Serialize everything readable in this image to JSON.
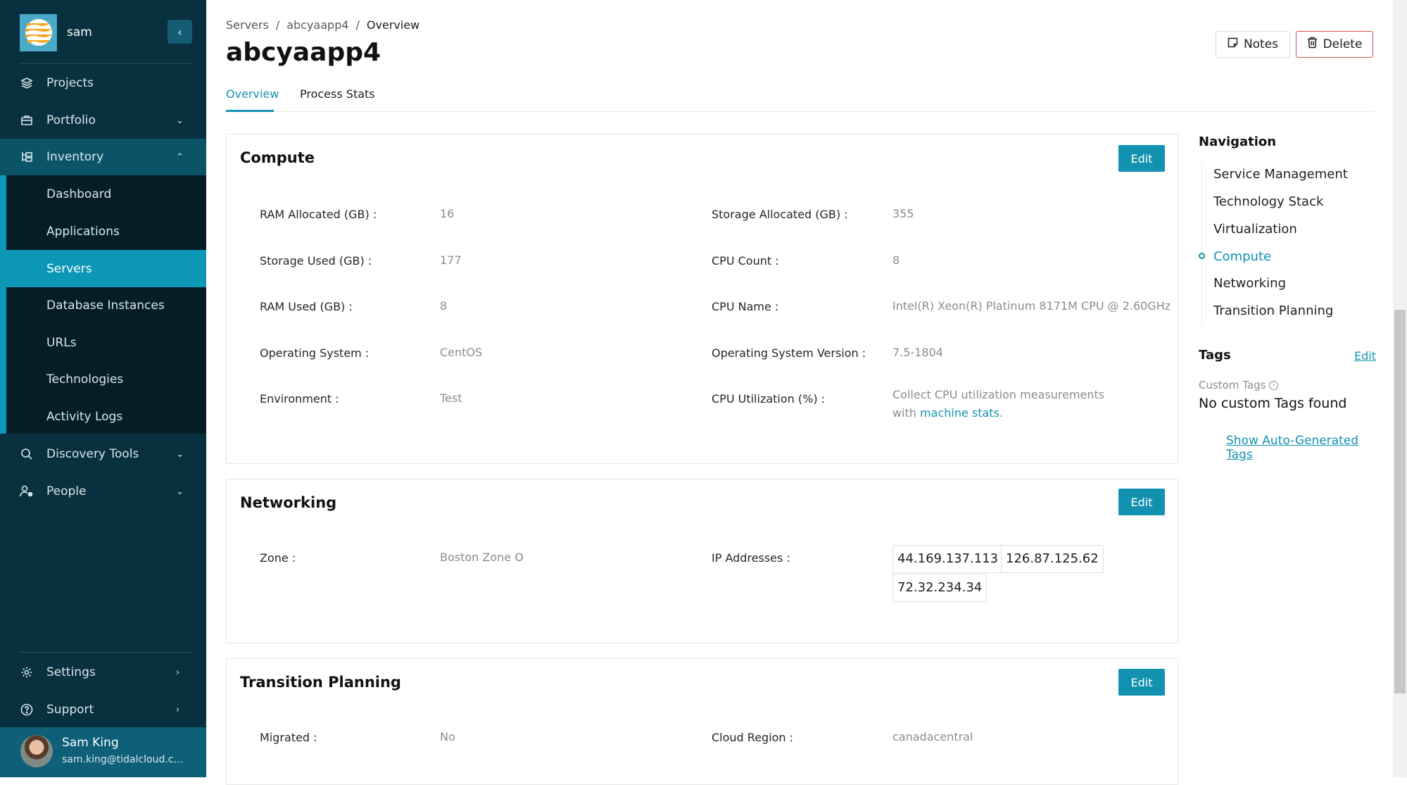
{
  "sidebar": {
    "org_name": "sam",
    "collapse_icon": "chevron-left-icon",
    "items": [
      {
        "label": "Projects",
        "icon": "layers-icon"
      },
      {
        "label": "Portfolio",
        "icon": "briefcase-icon",
        "chevron": "⌄"
      },
      {
        "label": "Inventory",
        "icon": "inventory-tree-icon",
        "chevron": "⌃"
      },
      {
        "label": "Discovery Tools",
        "icon": "search-icon",
        "chevron": "⌄"
      },
      {
        "label": "People",
        "icon": "people-gear-icon",
        "chevron": "⌄"
      }
    ],
    "inventory_subitems": [
      {
        "label": "Dashboard"
      },
      {
        "label": "Applications"
      },
      {
        "label": "Servers",
        "active": true
      },
      {
        "label": "Database Instances"
      },
      {
        "label": "URLs"
      },
      {
        "label": "Technologies"
      },
      {
        "label": "Activity Logs"
      }
    ],
    "bottom_items": [
      {
        "label": "Settings",
        "icon": "gear-icon",
        "chevron": "›"
      },
      {
        "label": "Support",
        "icon": "help-circle-icon",
        "chevron": "›"
      }
    ],
    "user": {
      "name": "Sam King",
      "email": "sam.king@tidalcloud.c..."
    }
  },
  "header": {
    "breadcrumb": [
      "Servers",
      "abcyaapp4",
      "Overview"
    ],
    "breadcrumb_separator": "/",
    "title": "abcyaapp4",
    "notes_label": "Notes",
    "delete_label": "Delete",
    "tabs": [
      {
        "label": "Overview",
        "active": true
      },
      {
        "label": "Process Stats"
      }
    ]
  },
  "colors": {
    "accent": "#1292b0",
    "sidebar_bg": "#08303f",
    "danger": "#d9534f"
  },
  "sections": {
    "compute": {
      "title": "Compute",
      "edit_label": "Edit",
      "left": [
        {
          "label": "RAM Allocated (GB)",
          "value": "16"
        },
        {
          "label": "Storage Used (GB)",
          "value": "177"
        },
        {
          "label": "RAM Used (GB)",
          "value": "8"
        },
        {
          "label": "Operating System",
          "value": "CentOS"
        },
        {
          "label": "Environment",
          "value": "Test"
        }
      ],
      "right": [
        {
          "label": "Storage Allocated (GB)",
          "value": "355"
        },
        {
          "label": "CPU Count",
          "value": "8"
        },
        {
          "label": "CPU Name",
          "value": "Intel(R) Xeon(R) Platinum 8171M CPU @ 2.60GHz"
        },
        {
          "label": "Operating System Version",
          "value": "7.5-1804"
        },
        {
          "label": "CPU Utilization (%)",
          "value": "Collect CPU utilization measurements with",
          "link": "machine stats",
          "suffix": "."
        }
      ]
    },
    "networking": {
      "title": "Networking",
      "edit_label": "Edit",
      "zone_label": "Zone",
      "zone_value": "Boston Zone O",
      "ip_label": "IP Addresses",
      "ips": [
        "44.169.137.113",
        "126.87.125.62",
        "72.32.234.34"
      ]
    },
    "transition": {
      "title": "Transition Planning",
      "edit_label": "Edit",
      "migrated_label": "Migrated",
      "migrated_value": "No",
      "region_label": "Cloud Region",
      "region_value": "canadacentral"
    }
  },
  "right_panel": {
    "nav_title": "Navigation",
    "anchors": [
      {
        "label": "Service Management"
      },
      {
        "label": "Technology Stack"
      },
      {
        "label": "Virtualization"
      },
      {
        "label": "Compute",
        "active": true
      },
      {
        "label": "Networking"
      },
      {
        "label": "Transition Planning"
      }
    ],
    "tags_title": "Tags",
    "tags_edit": "Edit",
    "custom_tags_label": "Custom Tags",
    "custom_tags_empty": "No custom Tags found",
    "show_auto_tags": "Show Auto-Generated Tags"
  }
}
